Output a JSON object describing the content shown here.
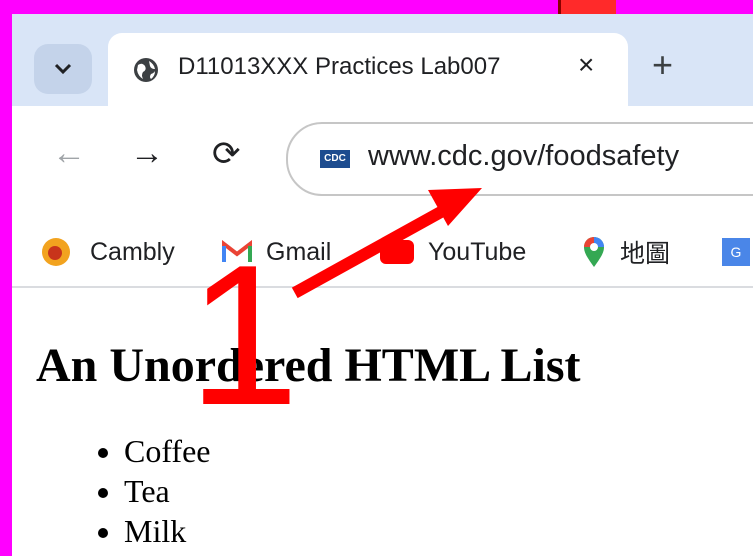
{
  "browser": {
    "tab": {
      "title": "D11013XXX Practices Lab007",
      "close_glyph": "×"
    },
    "new_tab_glyph": "+",
    "tab_menu_glyph": "⌄",
    "nav": {
      "back_glyph": "←",
      "forward_glyph": "→",
      "reload_glyph": "⟳"
    },
    "address_bar": {
      "favicon_label": "CDC",
      "url": "www.cdc.gov/foodsafety"
    },
    "bookmarks": [
      {
        "label": "Cambly",
        "icon": "cambly-icon"
      },
      {
        "label": "Gmail",
        "icon": "gmail-icon"
      },
      {
        "label": "YouTube",
        "icon": "youtube-icon"
      },
      {
        "label": "地圖",
        "icon": "maps-icon"
      },
      {
        "label": "",
        "icon": "translate-icon"
      }
    ]
  },
  "page": {
    "heading": "An Unordered HTML List",
    "items": [
      "Coffee",
      "Tea",
      "Milk"
    ]
  },
  "annotation": {
    "step_number": "1",
    "color": "#ff0000"
  },
  "colors": {
    "frame": "#ff00ff",
    "tabstrip": "#d9e5f7",
    "accent": "#ff0000"
  }
}
